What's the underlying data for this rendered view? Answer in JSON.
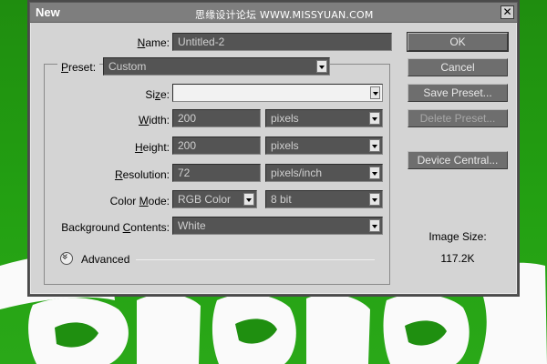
{
  "window": {
    "title": "New",
    "watermark": "思缘设计论坛 WWW.MISSYUAN.COM",
    "close_glyph": "✕"
  },
  "form": {
    "name": {
      "label": "Name:",
      "label_key": "N",
      "value": "Untitled-2"
    },
    "preset": {
      "label": "Preset:",
      "label_key": "P",
      "value": "Custom"
    },
    "size": {
      "label": "Size:",
      "label_key": "z",
      "value": ""
    },
    "width": {
      "label": "Width:",
      "label_key": "W",
      "value": "200",
      "unit": "pixels"
    },
    "height": {
      "label": "Height:",
      "label_key": "H",
      "value": "200",
      "unit": "pixels"
    },
    "resolution": {
      "label": "Resolution:",
      "label_key": "R",
      "value": "72",
      "unit": "pixels/inch"
    },
    "color_mode": {
      "label": "Color Mode:",
      "label_key": "M",
      "value": "RGB Color",
      "depth": "8 bit"
    },
    "background": {
      "label": "Background Contents:",
      "label_key": "C",
      "value": "White"
    },
    "advanced": {
      "label": "Advanced"
    }
  },
  "buttons": {
    "ok": "OK",
    "cancel": "Cancel",
    "save_preset": "Save Preset...",
    "delete_preset": "Delete Preset...",
    "device_central": "Device Central..."
  },
  "image_size": {
    "label": "Image Size:",
    "value": "117.2K"
  },
  "colors": {
    "background_green": "#1f8f10",
    "dialog_gray": "#d4d4d4",
    "field_dark": "#545454",
    "button_gray": "#6e6e6e"
  }
}
